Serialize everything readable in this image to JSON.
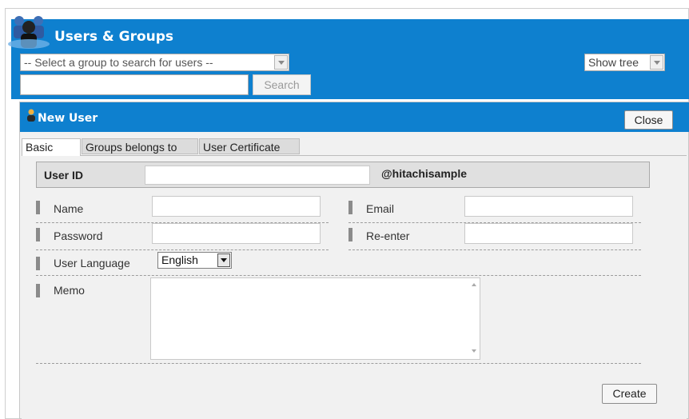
{
  "header": {
    "title": "Users & Groups",
    "group_select_placeholder": "-- Select a group to search for users --",
    "show_tree_label": "Show tree",
    "search_value": "",
    "search_button": "Search"
  },
  "panel": {
    "title": "New User",
    "close_button": "Close",
    "tabs": [
      {
        "label": "Basic",
        "active": true
      },
      {
        "label": "Groups belongs to",
        "active": false
      },
      {
        "label": "User Certificate",
        "active": false
      }
    ]
  },
  "form": {
    "user_id_label": "User ID",
    "user_id_value": "",
    "domain_suffix": "@hitachisample",
    "name_label": "Name",
    "name_value": "",
    "email_label": "Email",
    "email_value": "",
    "password_label": "Password",
    "password_value": "",
    "reenter_label": "Re-enter",
    "reenter_value": "",
    "language_label": "User Language",
    "language_value": "English",
    "memo_label": "Memo",
    "memo_value": "",
    "create_button": "Create"
  },
  "colors": {
    "brand_blue": "#0e80cf",
    "panel_bg": "#f1f1f1"
  }
}
